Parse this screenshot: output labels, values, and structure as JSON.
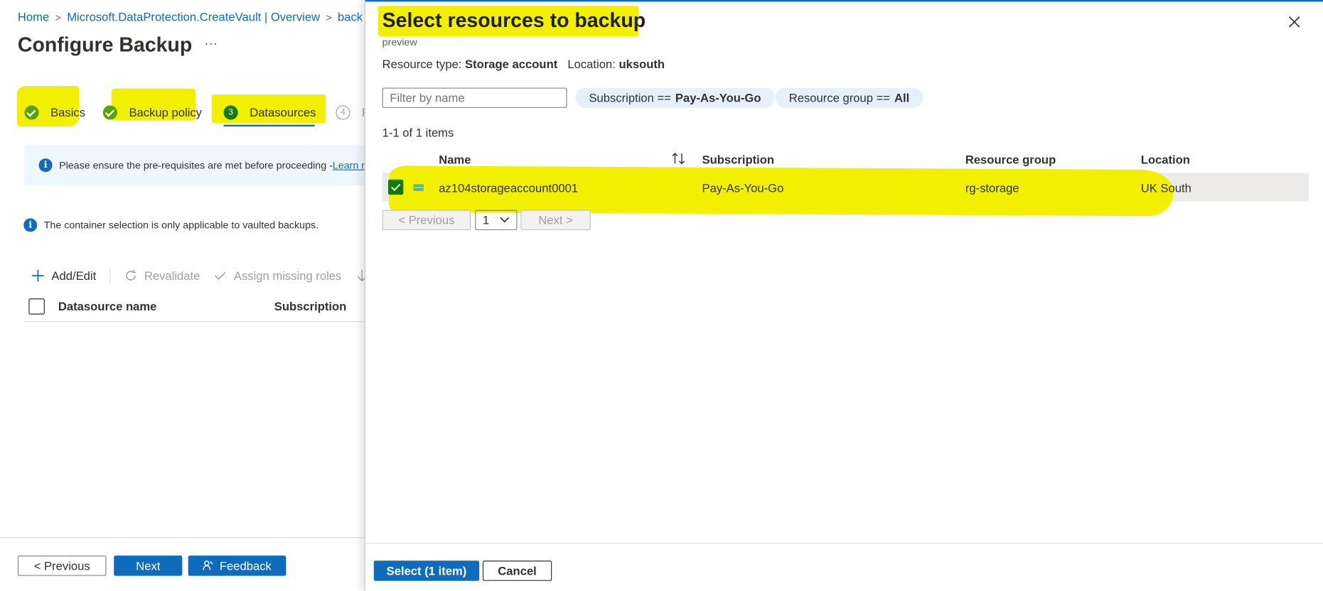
{
  "breadcrumb": {
    "home": "Home",
    "vault": "Microsoft.DataProtection.CreateVault | Overview",
    "current": "back"
  },
  "page": {
    "title": "Configure Backup",
    "more": "···"
  },
  "wizard": {
    "tabs": [
      {
        "label": "Basics",
        "state": "complete"
      },
      {
        "label": "Backup policy",
        "state": "complete"
      },
      {
        "num": "3",
        "label": "Datasources",
        "state": "active"
      },
      {
        "num": "4",
        "label": "R",
        "state": "pending"
      }
    ]
  },
  "banner": {
    "text": "Please ensure the pre-requisites are met before proceeding - ",
    "link": "Learn mo"
  },
  "note": {
    "text": "The container selection is only applicable to vaulted backups."
  },
  "toolbar": {
    "add_edit": "Add/Edit",
    "revalidate": "Revalidate",
    "assign_roles": "Assign missing roles",
    "download": "D"
  },
  "datasource_table": {
    "columns": [
      "Datasource name",
      "Subscription"
    ]
  },
  "footer": {
    "previous": "< Previous",
    "next": "Next",
    "feedback": "Feedback"
  },
  "panel": {
    "title": "Select resources to backup",
    "subtitle": "preview",
    "resource_type_label": "Resource type:",
    "resource_type_value": "Storage account",
    "location_label": "Location:",
    "location_value": "uksouth",
    "filter_placeholder": "Filter by name",
    "subscription_pill_label": "Subscription ==",
    "subscription_pill_value": "Pay-As-You-Go",
    "rg_pill_label": "Resource group ==",
    "rg_pill_value": "All",
    "count": "1-1 of 1 items",
    "columns": {
      "name": "Name",
      "subscription": "Subscription",
      "resource_group": "Resource group",
      "location": "Location"
    },
    "rows": [
      {
        "selected": true,
        "name": "az104storageaccount0001",
        "subscription": "Pay-As-You-Go",
        "resource_group": "rg-storage",
        "location": "UK South"
      }
    ],
    "pager": {
      "previous": "< Previous",
      "page": "1",
      "next": "Next >"
    },
    "select_button": "Select (1 item)",
    "cancel_button": "Cancel"
  },
  "colors": {
    "accent": "#0f6cbd",
    "success": "#57a300",
    "highlight": "#f2ef00"
  }
}
